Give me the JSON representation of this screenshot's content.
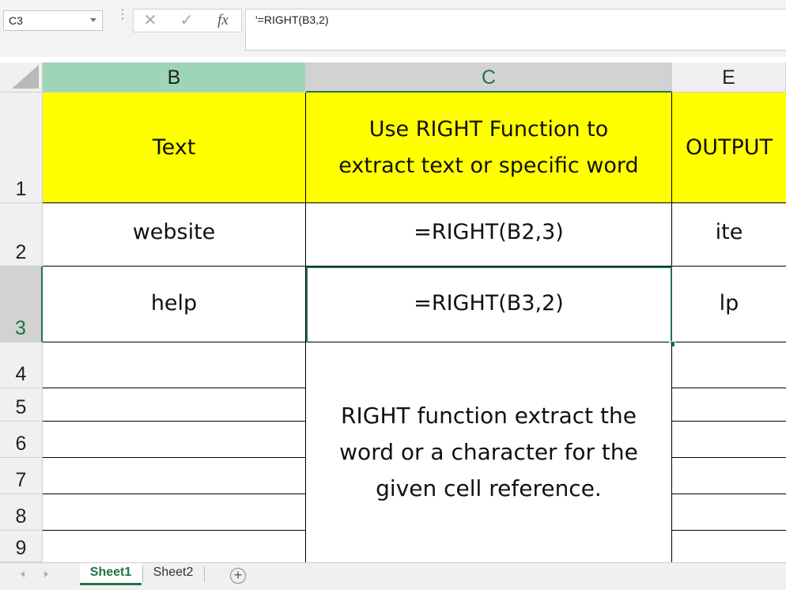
{
  "formula_bar": {
    "name_box": "C3",
    "cancel_icon": "✕",
    "enter_icon": "✓",
    "fx_label": "fx",
    "formula": "'=RIGHT(B3,2)"
  },
  "columns": [
    "B",
    "C",
    "E"
  ],
  "rows": [
    "1",
    "2",
    "3",
    "4",
    "5",
    "6",
    "7",
    "8",
    "9"
  ],
  "cells": {
    "B1": "Text",
    "C1": "Use RIGHT Function to extract  text or  specific word",
    "E1": "OUTPUT",
    "B2": "website",
    "C2": "=RIGHT(B2,3)",
    "E2": "ite",
    "B3": "help",
    "C3": "=RIGHT(B3,2)",
    "E3": "lp"
  },
  "note": "RIGHT function extract the word or a character for the given cell reference.",
  "sheet_tabs": [
    {
      "label": "Sheet1",
      "active": true
    },
    {
      "label": "Sheet2",
      "active": false
    }
  ],
  "add_sheet_icon": "+",
  "colors": {
    "header_fill": "#ffff00",
    "selection_accent": "#217346",
    "column_b_highlight": "#9fd5b7"
  }
}
